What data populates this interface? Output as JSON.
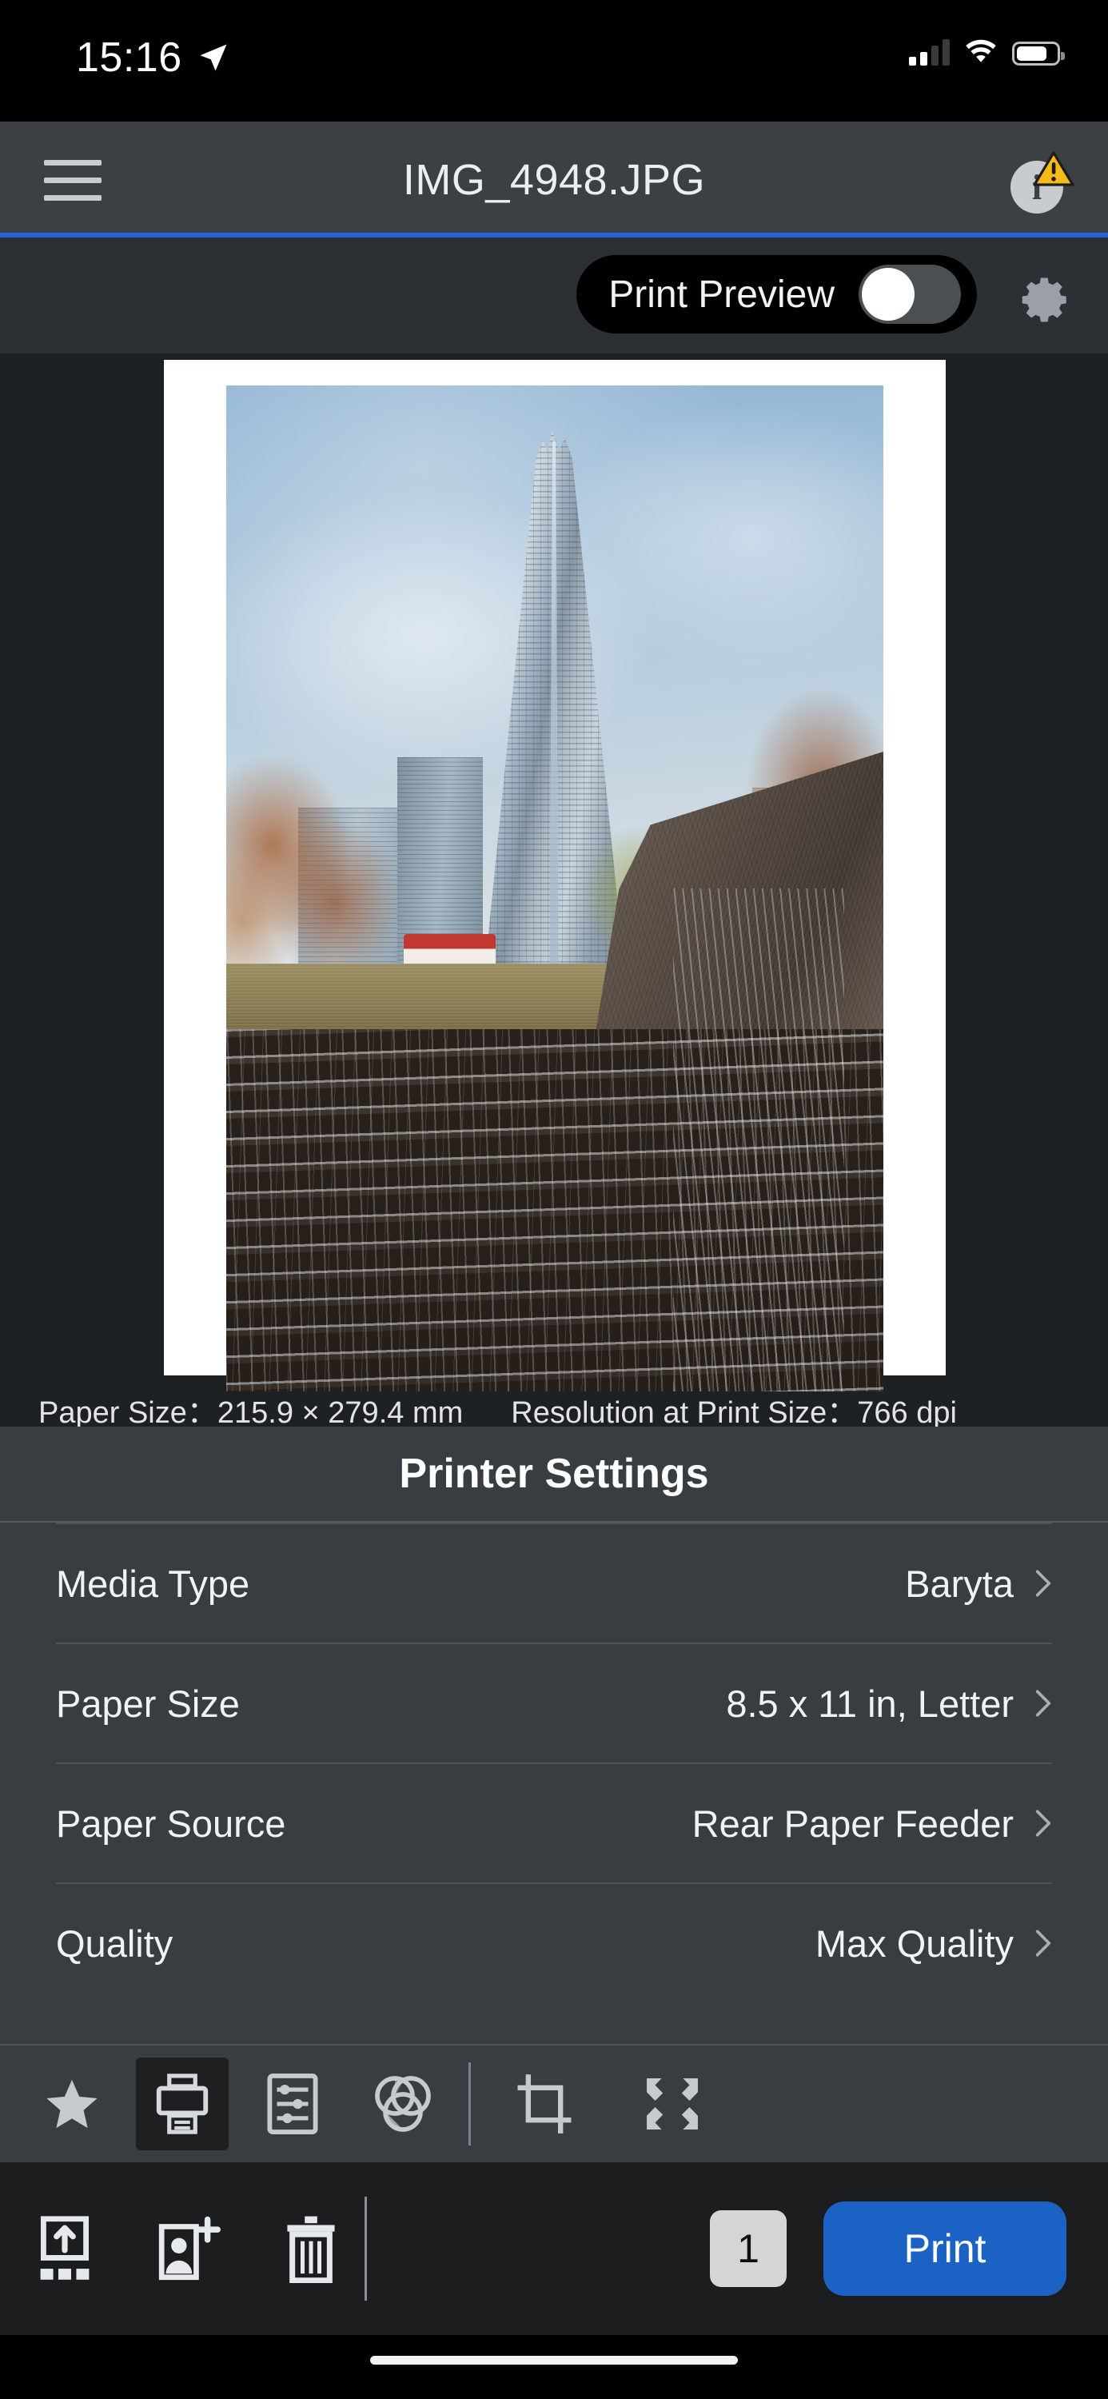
{
  "status_bar": {
    "time": "15:16",
    "location_icon": "location-arrow-icon",
    "signal_icon": "cellular-signal-icon",
    "signal_bars_filled": 2,
    "signal_bars_total": 4,
    "wifi_icon": "wifi-icon",
    "battery_icon": "battery-icon",
    "battery_level_percent": 75
  },
  "title_bar": {
    "menu_icon": "hamburger-menu-icon",
    "title": "IMG_4948.JPG",
    "info_icon": "info-icon",
    "warning_badge_icon": "warning-triangle-icon",
    "accent_color": "#2962d9"
  },
  "preview_toggle": {
    "label": "Print Preview",
    "toggle_state": "off",
    "gear_icon": "gear-icon"
  },
  "preview": {
    "paper_info": {
      "paper_size_label": "Paper Size：",
      "paper_size_value": "215.9 × 279.4 mm",
      "resolution_label": "Resolution at Print Size：",
      "resolution_value": "766 dpi"
    },
    "photo_description": "Upward view of a tall glass skyscraper with autumn trees and a cascading granite water fountain"
  },
  "printer_settings": {
    "title": "Printer Settings",
    "rows": [
      {
        "label": "Media Type",
        "value": "Baryta",
        "chevron": "chevron-right-icon"
      },
      {
        "label": "Paper Size",
        "value": "8.5 x 11 in, Letter",
        "chevron": "chevron-right-icon"
      },
      {
        "label": "Paper Source",
        "value": "Rear Paper Feeder",
        "chevron": "chevron-right-icon"
      },
      {
        "label": "Quality",
        "value": "Max Quality",
        "chevron": "chevron-right-icon"
      }
    ]
  },
  "toolbar": {
    "items": [
      {
        "icon": "star-icon",
        "selected": false
      },
      {
        "icon": "printer-icon",
        "selected": true
      },
      {
        "icon": "sliders-icon",
        "selected": false
      },
      {
        "icon": "color-circles-icon",
        "selected": false
      },
      {
        "icon": "crop-icon",
        "selected": false
      },
      {
        "icon": "expand-icon",
        "selected": false
      }
    ]
  },
  "bottom_bar": {
    "items": [
      {
        "icon": "export-icon"
      },
      {
        "icon": "add-person-icon"
      },
      {
        "icon": "trash-icon"
      }
    ],
    "copies_value": "1",
    "print_label": "Print",
    "print_color": "#1c62c4"
  }
}
